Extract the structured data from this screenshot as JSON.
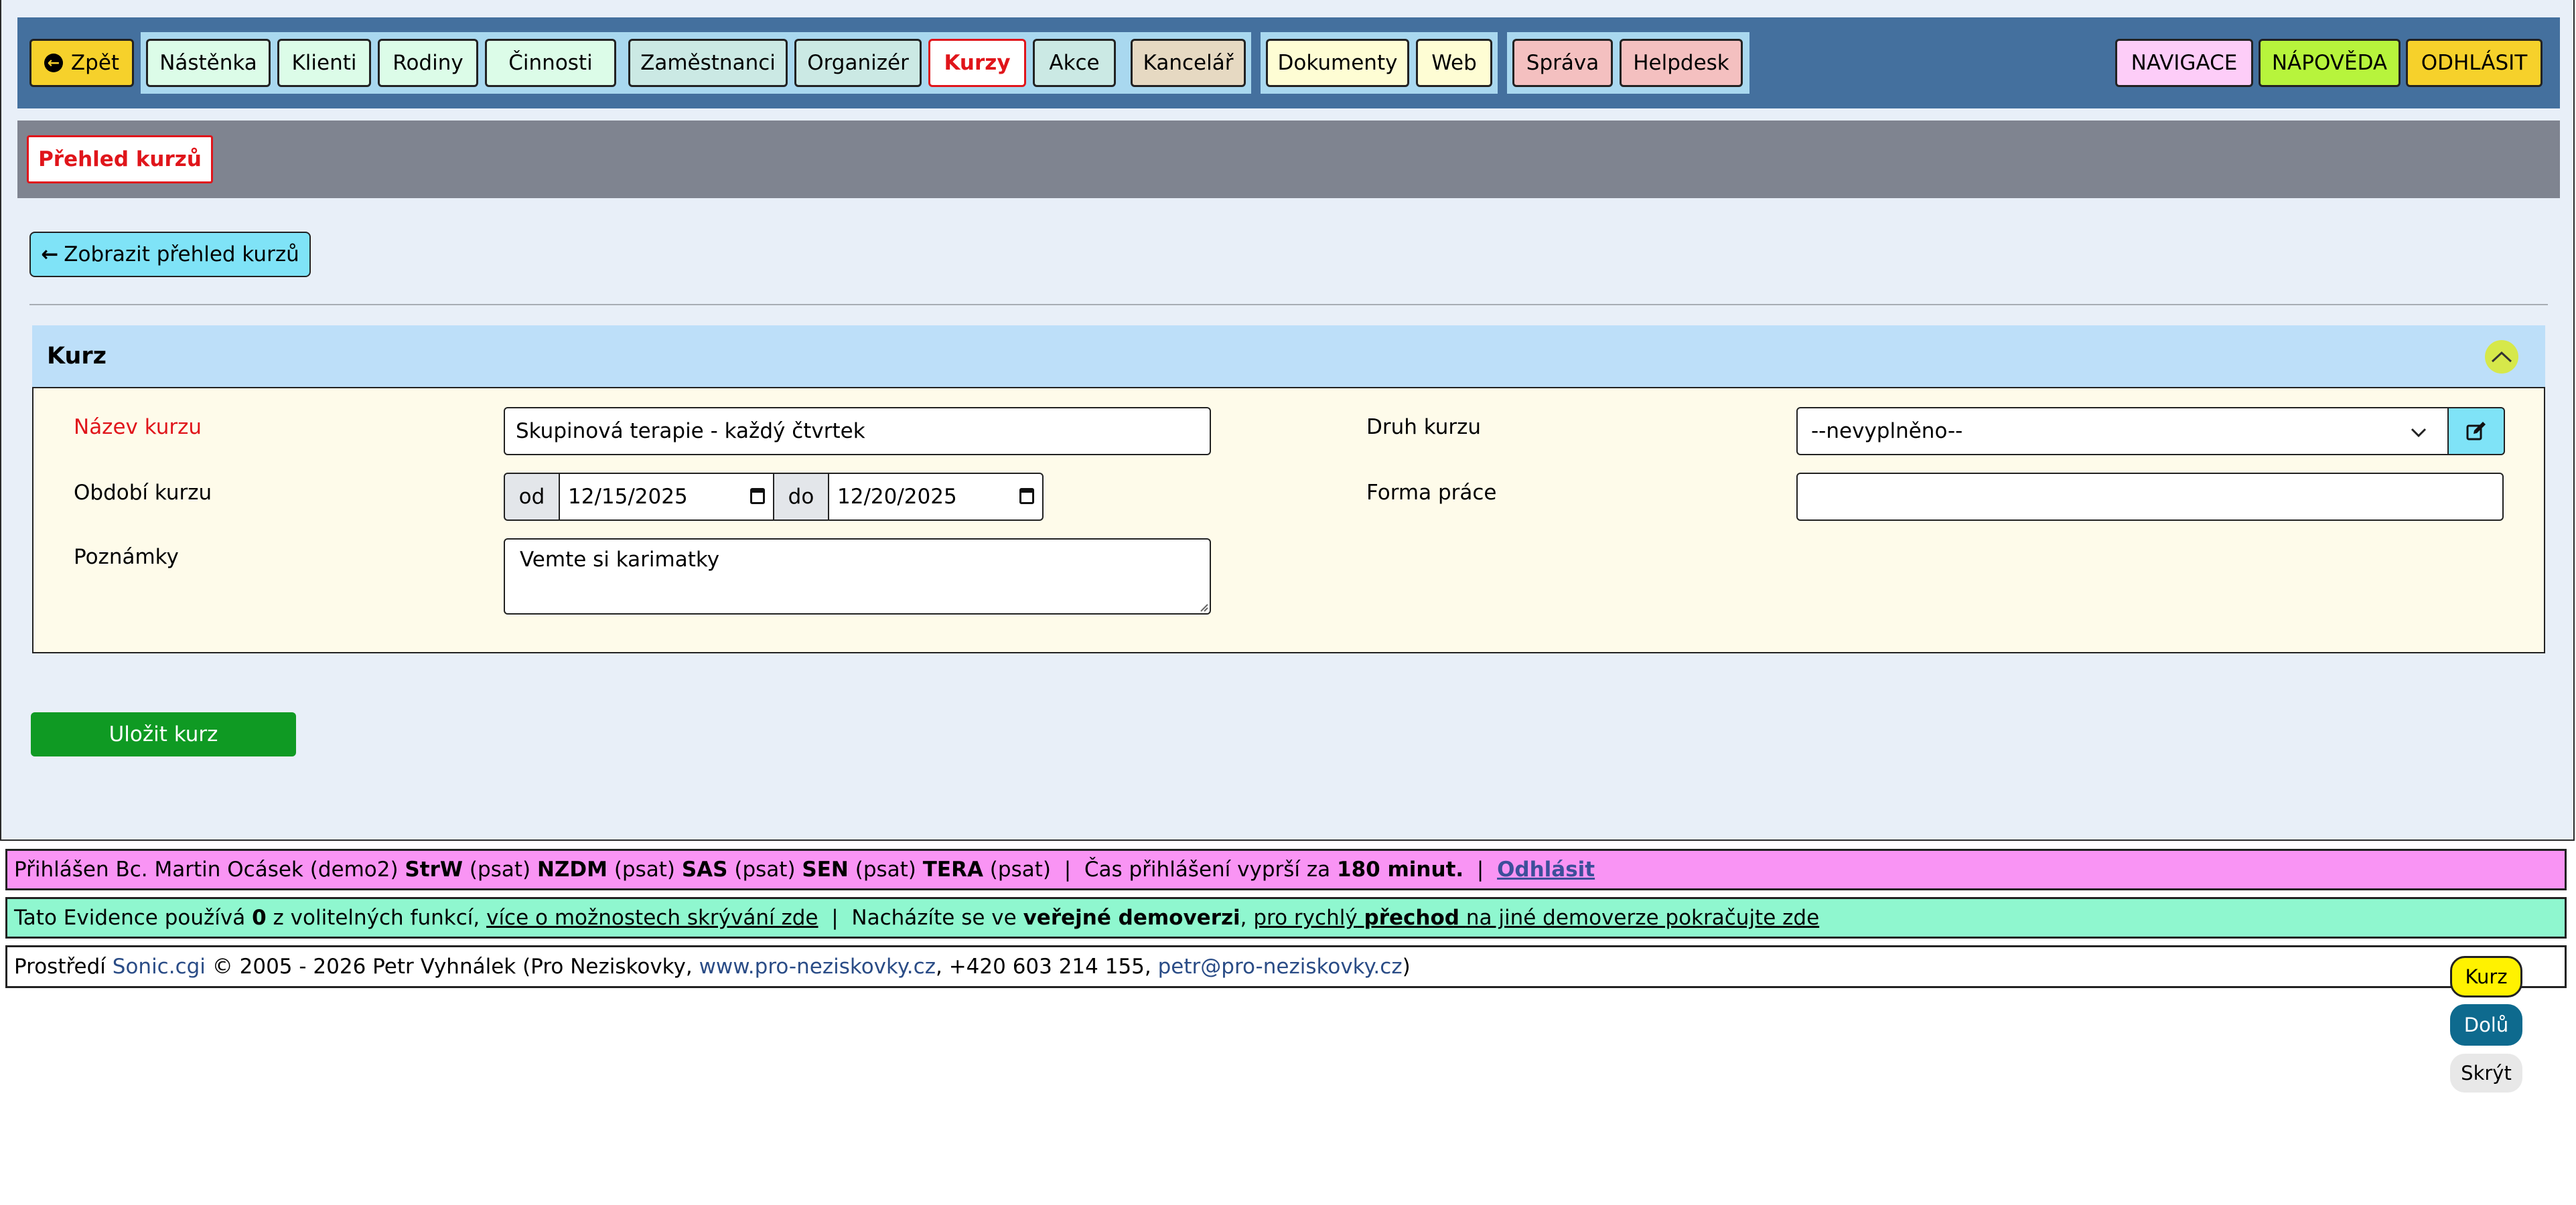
{
  "nav": {
    "back_label": "Zpět",
    "group1": [
      "Nástěnka",
      "Klienti",
      "Rodiny",
      "Činnosti"
    ],
    "group2": [
      "Zaměstnanci",
      "Organizér",
      "Kurzy",
      "Akce"
    ],
    "group3": [
      "Kancelář"
    ],
    "group4": [
      "Dokumenty",
      "Web"
    ],
    "group5": [
      "Správa",
      "Helpdesk"
    ],
    "right": [
      "NAVIGACE",
      "NÁPOVĚDA",
      "ODHLÁSIT"
    ],
    "active": "Kurzy"
  },
  "title_button": "Přehled kurzů",
  "show_overview_button": "Zobrazit přehled kurzů",
  "panel": {
    "title": "Kurz",
    "name_label": "Název kurzu",
    "name_value": "Skupinová terapie - každý čtvrtek",
    "period_label": "Období kurzu",
    "from_label": "od",
    "from_value": "12/15/2025",
    "to_label": "do",
    "to_value": "12/20/2025",
    "notes_label": "Poznámky",
    "notes_value": "Vemte si karimatky",
    "type_label": "Druh kurzu",
    "type_value": "--nevyplněno--",
    "form_label": "Forma práce",
    "form_value": ""
  },
  "save_button": "Uložit kurz",
  "footer": {
    "login": {
      "prefix": "Přihlášen Bc. Martin Ocásek (demo2)",
      "roles": [
        {
          "code": "StrW",
          "note": "(psat)"
        },
        {
          "code": "NZDM",
          "note": "(psat)"
        },
        {
          "code": "SAS",
          "note": "(psat)"
        },
        {
          "code": "SEN",
          "note": "(psat)"
        },
        {
          "code": "TERA",
          "note": "(psat)"
        }
      ],
      "sep": "|",
      "expire_text": "Čas přihlášení vyprší za",
      "expire_value": "180 minut.",
      "logout": "Odhlásit"
    },
    "evidence": {
      "t1": "Tato Evidence používá",
      "count": "0",
      "t2": "z volitelných funkcí,",
      "link1": "více o možnostech skrývání zde",
      "sep": "|",
      "t3": "Nacházíte se ve",
      "bold": "veřejné demoverzi",
      "link2a": "pro rychlý",
      "link2b": "přechod",
      "link2c": "na jiné demoverze pokračujte zde"
    },
    "copyright": {
      "t1": "Prostředí",
      "product": "Sonic.cgi",
      "t2": "© 2005 - 2026 Petr Vyhnálek (Pro Neziskovky,",
      "web": "www.pro-neziskovky.cz",
      "t3": ", +420 603 214 155,",
      "email": "petr@pro-neziskovky.cz",
      "t4": ")"
    }
  },
  "floating": [
    "Kurz",
    "Dolů",
    "Skrýt"
  ]
}
